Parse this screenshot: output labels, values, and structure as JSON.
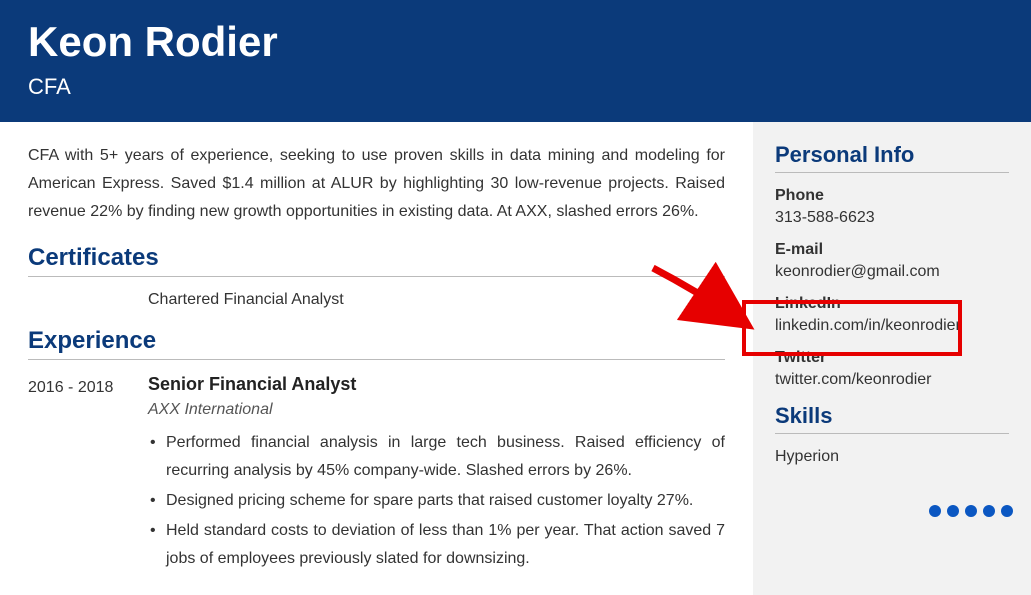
{
  "header": {
    "name": "Keon Rodier",
    "title": "CFA"
  },
  "summary": "CFA with 5+ years of experience, seeking to use proven skills in data mining and modeling for American Express. Saved $1.4 million at ALUR by highlighting 30 low-revenue projects. Raised revenue 22% by finding new growth opportunities in existing data. At AXX, slashed errors 26%.",
  "sections": {
    "certificates_title": "Certificates",
    "certificate": "Chartered Financial Analyst",
    "experience_title": "Experience"
  },
  "experience": {
    "dates": "2016 - 2018",
    "role": "Senior Financial Analyst",
    "company": "AXX International",
    "bullets": [
      "Performed financial analysis in large tech business. Raised efficiency of recurring analysis by 45% company-wide. Slashed errors by 26%.",
      "Designed pricing scheme for spare parts that raised customer loyalty 27%.",
      "Held standard costs to deviation of less than 1% per year. That action saved 7 jobs of employees previously slated for downsizing."
    ]
  },
  "sidebar": {
    "title": "Personal Info",
    "phone_label": "Phone",
    "phone": "313-588-6623",
    "email_label": "E-mail",
    "email": "keonrodier@gmail.com",
    "linkedin_label": "LinkedIn",
    "linkedin": "linkedin.com/in/keonrodier",
    "twitter_label": "Twitter",
    "twitter": "twitter.com/keonrodier",
    "skills_title": "Skills",
    "skills": [
      "Hyperion"
    ]
  }
}
